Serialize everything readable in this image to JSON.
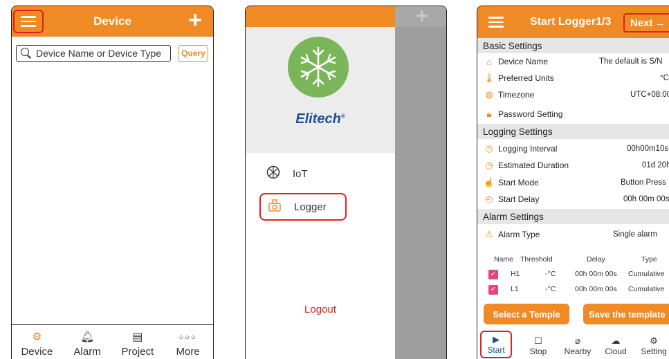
{
  "colors": {
    "accent": "#f08a24",
    "highlight": "#e02020",
    "brand_blue": "#1f4e9b",
    "check": "#e8437e"
  },
  "device_screen": {
    "title": "Device",
    "add_icon": "plus-icon",
    "search": {
      "placeholder": "Device Name or Device Type",
      "icon": "search-icon"
    },
    "query_label": "Query",
    "tabs": [
      {
        "label": "Device",
        "icon": "gear-device-icon",
        "active": true
      },
      {
        "label": "Alarm",
        "icon": "bell-icon"
      },
      {
        "label": "Project",
        "icon": "document-icon"
      },
      {
        "label": "More",
        "icon": "more-icon"
      }
    ]
  },
  "menu_screen": {
    "logo_text": "Elitech",
    "logo_mark": "®",
    "items": [
      {
        "label": "IoT",
        "icon": "network-icon"
      },
      {
        "label": "Logger",
        "icon": "logger-icon"
      }
    ],
    "logout_label": "Logout"
  },
  "logger_screen": {
    "title": "Start Logger1/3",
    "next_label": "Next",
    "sections": {
      "basic": "Basic Settings",
      "logging": "Logging Settings",
      "alarm": "Alarm Settings"
    },
    "basic_rows": [
      {
        "label": "Device Name",
        "value": "The default  is  S/N",
        "icon": "tag-icon"
      },
      {
        "label": "Preferred Units",
        "value": "°C",
        "icon": "thermometer-icon"
      },
      {
        "label": "Timezone",
        "value": "UTC+08:00",
        "icon": "globe-icon"
      },
      {
        "label": "Password Setting",
        "value": "",
        "icon": "lock-icon"
      }
    ],
    "logging_rows": [
      {
        "label": "Logging Interval",
        "value": "00h00m10s",
        "icon": "clock-icon"
      },
      {
        "label": "Estimated Duration",
        "value": "01d 20h",
        "icon": "clock-icon"
      },
      {
        "label": "Start Mode",
        "value": "Button Press",
        "icon": "hand-icon"
      },
      {
        "label": "Start Delay",
        "value": "00h 00m 00s",
        "icon": "timer-icon"
      }
    ],
    "alarm_type": {
      "label": "Alarm Type",
      "value": "Single alarm",
      "icon": "alarm-light-icon"
    },
    "alarm_headers": [
      "Name",
      "Threshold",
      "Delay",
      "Type"
    ],
    "alarm_rows": [
      {
        "name": "H1",
        "threshold": "-°C",
        "delay": "00h 00m 00s",
        "type": "Cumulative",
        "checked": true
      },
      {
        "name": "L1",
        "threshold": "-°C",
        "delay": "00h 00m 00s",
        "type": "Cumulative",
        "checked": true
      }
    ],
    "select_template_label": "Select a Temple",
    "save_template_label": "Save the template",
    "tabs": [
      {
        "label": "Start",
        "icon": "play-icon",
        "active": true
      },
      {
        "label": "Stop",
        "icon": "stop-icon"
      },
      {
        "label": "Nearby",
        "icon": "compass-icon"
      },
      {
        "label": "Cloud",
        "icon": "cloud-icon"
      },
      {
        "label": "Setting",
        "icon": "gear-icon"
      }
    ]
  }
}
